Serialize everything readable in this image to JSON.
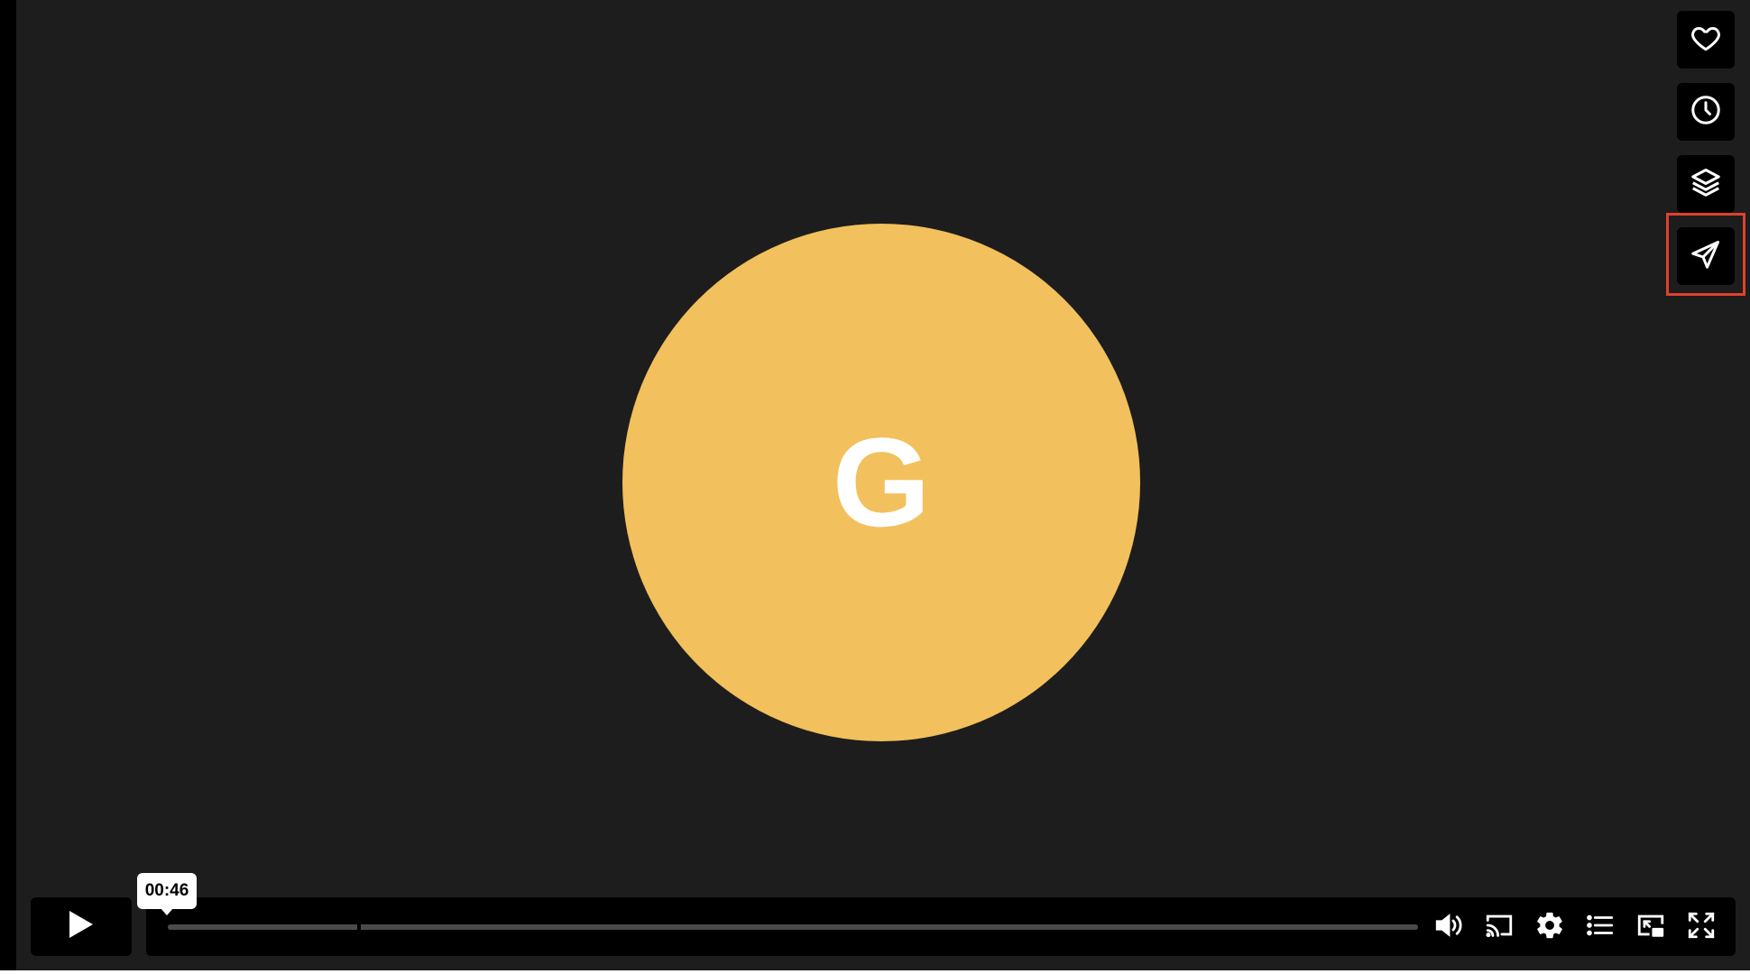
{
  "player": {
    "avatar_letter": "G",
    "avatar_color": "#f2c05c",
    "background_color": "#1d1d1d"
  },
  "side_actions": [
    {
      "name": "like",
      "icon": "heart-icon"
    },
    {
      "name": "watch-later",
      "icon": "clock-icon"
    },
    {
      "name": "collections",
      "icon": "layers-icon"
    },
    {
      "name": "share",
      "icon": "paper-plane-icon",
      "highlighted": true
    }
  ],
  "controls": {
    "play_icon": "play-icon",
    "hover_time": "00:46",
    "right_icons": [
      "volume-icon",
      "cast-icon",
      "settings-icon",
      "chapters-list-icon",
      "picture-in-picture-icon",
      "fullscreen-icon"
    ]
  },
  "highlight_color": "#e0412b"
}
